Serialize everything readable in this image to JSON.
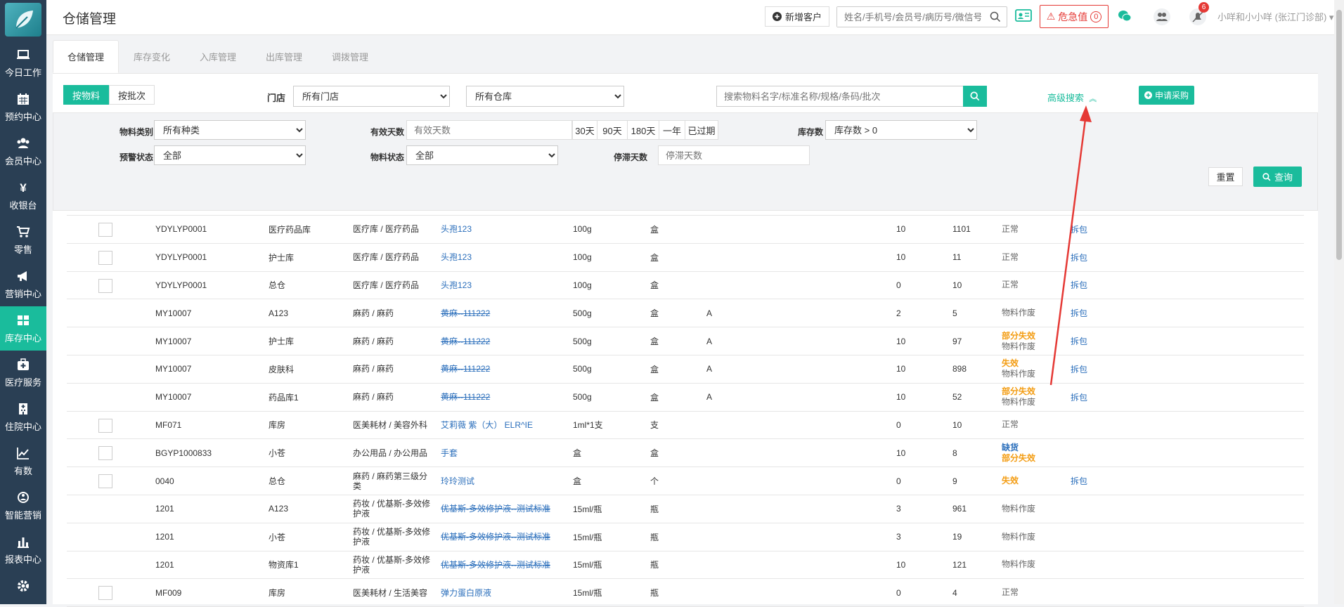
{
  "sidebar": {
    "items": [
      {
        "label": "今日工作",
        "icon": "laptop-icon"
      },
      {
        "label": "预约中心",
        "icon": "calendar-icon"
      },
      {
        "label": "会员中心",
        "icon": "users-icon"
      },
      {
        "label": "收银台",
        "icon": "yen-icon"
      },
      {
        "label": "零售",
        "icon": "cart-icon"
      },
      {
        "label": "营销中心",
        "icon": "megaphone-icon"
      },
      {
        "label": "库存中心",
        "icon": "grid-icon"
      },
      {
        "label": "医疗服务",
        "icon": "medkit-icon"
      },
      {
        "label": "住院中心",
        "icon": "hospital-icon"
      },
      {
        "label": "有数",
        "icon": "chart-line-icon"
      },
      {
        "label": "智能营销",
        "icon": "smart-icon"
      },
      {
        "label": "报表中心",
        "icon": "bar-chart-icon"
      }
    ],
    "active_index": 6
  },
  "header": {
    "title": "仓储管理",
    "new_customer": "新增客户",
    "search_placeholder": "姓名/手机号/会员号/病历号/微信号",
    "danger_label": "危急值",
    "danger_count": "0",
    "notif_count": "6",
    "user": "小咩和小小咩 (张江门诊部)"
  },
  "tabs": [
    "仓储管理",
    "库存变化",
    "入库管理",
    "出库管理",
    "调拨管理"
  ],
  "toolbar": {
    "by_material": "按物料",
    "by_batch": "按批次",
    "store_label": "门店",
    "store_value": "所有门店",
    "warehouse_value": "所有仓库",
    "search_placeholder": "搜索物料名字/标准名称/规格/条码/批次",
    "advanced": "高级搜索",
    "apply_purchase": "申请采购"
  },
  "filters": {
    "category_label": "物料类别",
    "category_value": "所有种类",
    "valid_days_label": "有效天数",
    "valid_days_placeholder": "有效天数",
    "day_buttons": [
      "30天",
      "90天",
      "180天",
      "一年",
      "已过期"
    ],
    "stock_label": "库存数",
    "stock_value": "库存数 > 0",
    "warn_label": "预警状态",
    "warn_value": "全部",
    "mstatus_label": "物料状态",
    "mstatus_value": "全部",
    "stagnant_label": "停滞天数",
    "stagnant_placeholder": "停滞天数",
    "reset": "重置",
    "query": "查询"
  },
  "rows": [
    {
      "checkbox": true,
      "code": "YDYLYP0001",
      "warehouse": "医疗药品库",
      "category": "医疗库 / 医疗药品",
      "name": "头孢123",
      "strike": false,
      "spec": "100g",
      "unit": "盒",
      "note": "",
      "warn": "10",
      "stock": "1101",
      "status": [
        {
          "t": "正常",
          "c": "gray"
        }
      ],
      "action": "拆包"
    },
    {
      "checkbox": true,
      "code": "YDYLYP0001",
      "warehouse": "护士库",
      "category": "医疗库 / 医疗药品",
      "name": "头孢123",
      "strike": false,
      "spec": "100g",
      "unit": "盒",
      "note": "",
      "warn": "10",
      "stock": "11",
      "status": [
        {
          "t": "正常",
          "c": "gray"
        }
      ],
      "action": "拆包"
    },
    {
      "checkbox": true,
      "code": "YDYLYP0001",
      "warehouse": "总仓",
      "category": "医疗库 / 医疗药品",
      "name": "头孢123",
      "strike": false,
      "spec": "100g",
      "unit": "盒",
      "note": "",
      "warn": "0",
      "stock": "10",
      "status": [
        {
          "t": "正常",
          "c": "gray"
        }
      ],
      "action": "拆包"
    },
    {
      "checkbox": false,
      "code": "MY10007",
      "warehouse": "A123",
      "category": "麻药 / 麻药",
      "name": "黄麻--111222",
      "strike": true,
      "spec": "500g",
      "unit": "盒",
      "note": "A",
      "warn": "2",
      "stock": "5",
      "status": [
        {
          "t": "物料作废",
          "c": "gray"
        }
      ],
      "action": "拆包"
    },
    {
      "checkbox": false,
      "code": "MY10007",
      "warehouse": "护士库",
      "category": "麻药 / 麻药",
      "name": "黄麻--111222",
      "strike": true,
      "spec": "500g",
      "unit": "盒",
      "note": "A",
      "warn": "10",
      "stock": "97",
      "status": [
        {
          "t": "部分失效",
          "c": "orange"
        },
        {
          "t": "物料作废",
          "c": "gray"
        }
      ],
      "action": "拆包"
    },
    {
      "checkbox": false,
      "code": "MY10007",
      "warehouse": "皮肤科",
      "category": "麻药 / 麻药",
      "name": "黄麻--111222",
      "strike": true,
      "spec": "500g",
      "unit": "盒",
      "note": "A",
      "warn": "10",
      "stock": "898",
      "status": [
        {
          "t": "失效",
          "c": "orange"
        },
        {
          "t": "物料作废",
          "c": "gray"
        }
      ],
      "action": "拆包"
    },
    {
      "checkbox": false,
      "code": "MY10007",
      "warehouse": "药品库1",
      "category": "麻药 / 麻药",
      "name": "黄麻--111222",
      "strike": true,
      "spec": "500g",
      "unit": "盒",
      "note": "A",
      "warn": "10",
      "stock": "52",
      "status": [
        {
          "t": "部分失效",
          "c": "orange"
        },
        {
          "t": "物料作废",
          "c": "gray"
        }
      ],
      "action": "拆包"
    },
    {
      "checkbox": true,
      "code": "MF071",
      "warehouse": "库房",
      "category": "医美耗材 / 美容外科",
      "name": "艾莉薇 紫（大） ELR^IE",
      "strike": false,
      "spec": "1ml*1支",
      "unit": "支",
      "note": "",
      "warn": "0",
      "stock": "10",
      "status": [
        {
          "t": "正常",
          "c": "gray"
        }
      ],
      "action": ""
    },
    {
      "checkbox": true,
      "code": "BGYP1000833",
      "warehouse": "小苍",
      "category": "办公用品 / 办公用品",
      "name": "手套",
      "strike": false,
      "spec": "盒",
      "unit": "盒",
      "note": "",
      "warn": "10",
      "stock": "8",
      "status": [
        {
          "t": "缺货",
          "c": "blue"
        },
        {
          "t": "部分失效",
          "c": "orange"
        }
      ],
      "action": ""
    },
    {
      "checkbox": true,
      "code": "0040",
      "warehouse": "总仓",
      "category": "麻药 / 麻药第三级分类",
      "name": "玲玲测试",
      "strike": false,
      "spec": "盒",
      "unit": "个",
      "note": "",
      "warn": "0",
      "stock": "9",
      "status": [
        {
          "t": "失效",
          "c": "orange"
        }
      ],
      "action": "拆包"
    },
    {
      "checkbox": false,
      "code": "1201",
      "warehouse": "A123",
      "category": "药妆 / 优基斯-多效修护液",
      "name": "优基斯-多效修护液--测试标准",
      "strike": true,
      "spec": "15ml/瓶",
      "unit": "瓶",
      "note": "",
      "warn": "3",
      "stock": "961",
      "status": [
        {
          "t": "物料作废",
          "c": "gray"
        }
      ],
      "action": ""
    },
    {
      "checkbox": false,
      "code": "1201",
      "warehouse": "小苍",
      "category": "药妆 / 优基斯-多效修护液",
      "name": "优基斯-多效修护液--测试标准",
      "strike": true,
      "spec": "15ml/瓶",
      "unit": "瓶",
      "note": "",
      "warn": "3",
      "stock": "19",
      "status": [
        {
          "t": "物料作废",
          "c": "gray"
        }
      ],
      "action": ""
    },
    {
      "checkbox": false,
      "code": "1201",
      "warehouse": "物资库1",
      "category": "药妆 / 优基斯-多效修护液",
      "name": "优基斯-多效修护液--测试标准",
      "strike": true,
      "spec": "15ml/瓶",
      "unit": "瓶",
      "note": "",
      "warn": "10",
      "stock": "121",
      "status": [
        {
          "t": "物料作废",
          "c": "gray"
        }
      ],
      "action": ""
    },
    {
      "checkbox": true,
      "code": "MF009",
      "warehouse": "库房",
      "category": "医美耗材 / 生活美容",
      "name": "弹力蛋白原液",
      "strike": false,
      "spec": "15ml/瓶",
      "unit": "瓶",
      "note": "",
      "warn": "0",
      "stock": "4",
      "status": [
        {
          "t": "正常",
          "c": "gray"
        }
      ],
      "action": ""
    }
  ],
  "colors": {
    "accent": "#1abc9c",
    "sidebar": "#2a3f54",
    "danger": "#e53935",
    "warning": "#f39c12",
    "link": "#2a6ebb"
  }
}
